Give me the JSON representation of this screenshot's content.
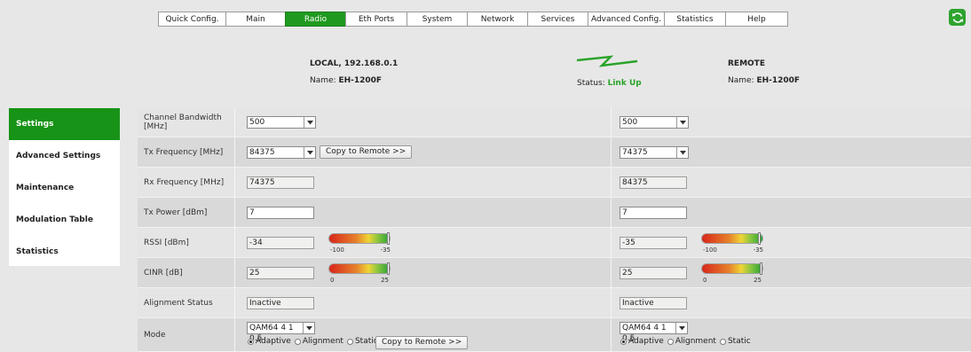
{
  "nav": {
    "tabs": [
      "Quick Config.",
      "Main",
      "Radio",
      "Eth Ports",
      "System",
      "Network",
      "Services",
      "Advanced Config.",
      "Statistics",
      "Help"
    ],
    "active_tab": "Radio",
    "refresh_icon": "refresh-icon"
  },
  "header": {
    "local_title": "LOCAL, 192.168.0.1",
    "local_name_label": "Name:",
    "local_name_value": "EH-1200F",
    "status_label": "Status:",
    "status_value": "Link Up",
    "remote_title": "REMOTE",
    "remote_name_label": "Name:",
    "remote_name_value": "EH-1200F",
    "link_color": "#2aa32a"
  },
  "sidebar": {
    "items": [
      "Settings",
      "Advanced Settings",
      "Maintenance",
      "Modulation Table",
      "Statistics"
    ],
    "active": "Settings"
  },
  "rows": {
    "channel_bw": {
      "label": "Channel Bandwidth [MHz]",
      "local": "500",
      "remote": "500"
    },
    "tx_freq": {
      "label": "Tx Frequency [MHz]",
      "local": "84375",
      "remote": "74375",
      "copy_button": "Copy to Remote >>"
    },
    "rx_freq": {
      "label": "Rx Frequency [MHz]",
      "local": "74375",
      "remote": "84375"
    },
    "tx_power": {
      "label": "Tx Power [dBm]",
      "local": "7",
      "remote": "7"
    },
    "rssi": {
      "label": "RSSI [dBm]",
      "local": "-34",
      "remote": "-35",
      "meter_min": "-100",
      "meter_max": "-35",
      "local_fraction": 0.98,
      "remote_fraction": 0.96
    },
    "cinr": {
      "label": "CINR [dB]",
      "local": "25",
      "remote": "25",
      "meter_min": "0",
      "meter_max": "25",
      "local_fraction": 0.98,
      "remote_fraction": 0.98
    },
    "alignment": {
      "label": "Alignment Status",
      "local": "Inactive",
      "remote": "Inactive"
    },
    "mode": {
      "label": "Mode",
      "local": "QAM64 4 1 0.5",
      "remote": "QAM64 4 1 0.5",
      "options": [
        "Adaptive",
        "Alignment",
        "Static"
      ],
      "selected": "Adaptive",
      "copy_button": "Copy to Remote >>"
    }
  }
}
